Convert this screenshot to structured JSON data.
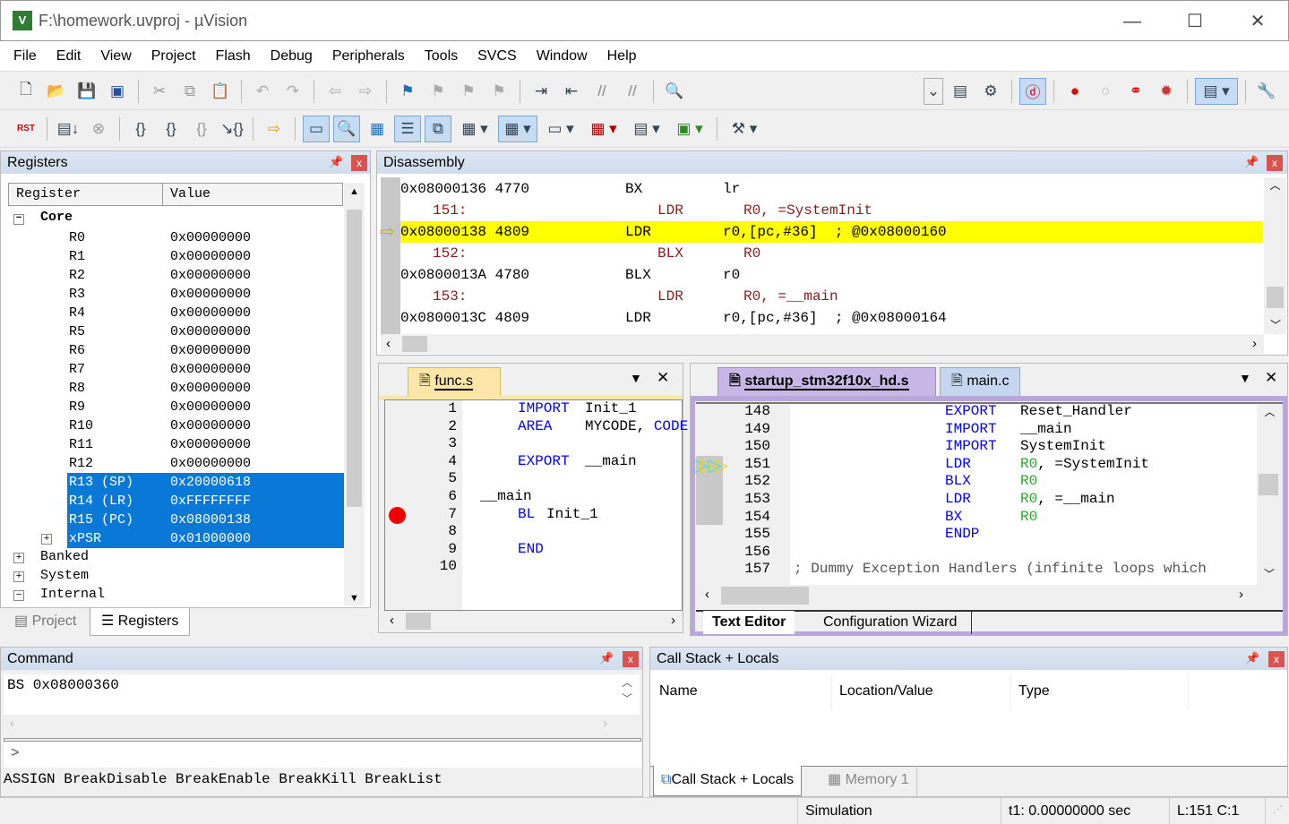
{
  "window": {
    "title": "F:\\homework.uvproj - µVision",
    "minimize": "—",
    "maximize": "☐",
    "close": "✕"
  },
  "menu": [
    "File",
    "Edit",
    "View",
    "Project",
    "Flash",
    "Debug",
    "Peripherals",
    "Tools",
    "SVCS",
    "Window",
    "Help"
  ],
  "toolbar1": [
    "new-file",
    "open-file",
    "save",
    "save-all",
    "cut",
    "copy",
    "paste",
    "undo",
    "redo",
    "back",
    "forward",
    "bookmark",
    "prev-bookmark",
    "next-bookmark",
    "clear-bookmarks",
    "indent",
    "unindent",
    "comment",
    "uncomment",
    "find-in-files",
    "select-target",
    "batch-build",
    "debug-session",
    "breakpoint-insert",
    "breakpoint-disable",
    "breakpoints-kill",
    "configure"
  ],
  "toolbar2": [
    "reset",
    "run",
    "stop",
    "step",
    "step-over",
    "step-out",
    "run-to-cursor",
    "show-next-statement",
    "command-window",
    "disassembly-window",
    "symbols-window",
    "registers-window",
    "call-stack-window",
    "watch-windows",
    "memory-windows",
    "serial-windows",
    "analysis-windows",
    "trace-windows",
    "system-viewer",
    "toolbox"
  ],
  "registers": {
    "title": "Registers",
    "col_register": "Register",
    "col_value": "Value",
    "core_label": "Core",
    "rows": [
      {
        "name": "R0",
        "value": "0x00000000"
      },
      {
        "name": "R1",
        "value": "0x00000000"
      },
      {
        "name": "R2",
        "value": "0x00000000"
      },
      {
        "name": "R3",
        "value": "0x00000000"
      },
      {
        "name": "R4",
        "value": "0x00000000"
      },
      {
        "name": "R5",
        "value": "0x00000000"
      },
      {
        "name": "R6",
        "value": "0x00000000"
      },
      {
        "name": "R7",
        "value": "0x00000000"
      },
      {
        "name": "R8",
        "value": "0x00000000"
      },
      {
        "name": "R9",
        "value": "0x00000000"
      },
      {
        "name": "R10",
        "value": "0x00000000"
      },
      {
        "name": "R11",
        "value": "0x00000000"
      },
      {
        "name": "R12",
        "value": "0x00000000"
      },
      {
        "name": "R13 (SP)",
        "value": "0x20000618",
        "selected": true
      },
      {
        "name": "R14 (LR)",
        "value": "0xFFFFFFFF",
        "selected": true
      },
      {
        "name": "R15 (PC)",
        "value": "0x08000138",
        "selected": true
      },
      {
        "name": "xPSR",
        "value": "0x01000000",
        "selected": true
      }
    ],
    "groups": [
      "Banked",
      "System",
      "Internal"
    ],
    "tabs": [
      "Project",
      "Registers"
    ]
  },
  "disassembly": {
    "title": "Disassembly",
    "lines": [
      {
        "type": "asm",
        "addr": "0x08000136 4770",
        "op": "BX",
        "args": "lr"
      },
      {
        "type": "src",
        "line": "151:",
        "op": "LDR",
        "args": "R0, =SystemInit"
      },
      {
        "type": "asm",
        "addr": "0x08000138 4809",
        "op": "LDR",
        "args": "r0,[pc,#36]  ; @0x08000160",
        "current": true
      },
      {
        "type": "src",
        "line": "152:",
        "op": "BLX",
        "args": "R0"
      },
      {
        "type": "asm",
        "addr": "0x0800013A 4780",
        "op": "BLX",
        "args": "r0"
      },
      {
        "type": "src",
        "line": "153:",
        "op": "LDR",
        "args": "R0, =__main"
      },
      {
        "type": "asm",
        "addr": "0x0800013C 4809",
        "op": "LDR",
        "args": "r0,[pc,#36]  ; @0x08000164"
      }
    ]
  },
  "func_editor": {
    "tab": "func.s",
    "lines": [
      {
        "n": "1",
        "label": "",
        "op": "IMPORT",
        "args": "Init_1"
      },
      {
        "n": "2",
        "label": "",
        "op": "AREA",
        "args": "MYCODE, ",
        "args2": "CODE"
      },
      {
        "n": "3",
        "label": "",
        "op": "",
        "args": ""
      },
      {
        "n": "4",
        "label": "",
        "op": "EXPORT",
        "args": "__main"
      },
      {
        "n": "5",
        "label": "",
        "op": "",
        "args": ""
      },
      {
        "n": "6",
        "label": "__main",
        "op": "",
        "args": ""
      },
      {
        "n": "7",
        "label": "",
        "op": "BL",
        "args": "Init_1",
        "breakpoint": true
      },
      {
        "n": "8",
        "label": "",
        "op": "",
        "args": ""
      },
      {
        "n": "9",
        "label": "",
        "op": "END",
        "args": ""
      },
      {
        "n": "10",
        "label": "",
        "op": "",
        "args": ""
      }
    ]
  },
  "startup_editor": {
    "tabs": [
      "startup_stm32f10x_hd.s",
      "main.c"
    ],
    "bottom_tabs": [
      "Text Editor",
      "Configuration Wizard"
    ],
    "lines": [
      {
        "n": "148",
        "op": "EXPORT",
        "reg": "",
        "args": "Reset_Handler"
      },
      {
        "n": "149",
        "op": "IMPORT",
        "reg": "",
        "args": "__main"
      },
      {
        "n": "150",
        "op": "IMPORT",
        "reg": "",
        "args": "SystemInit"
      },
      {
        "n": "151",
        "op": "LDR",
        "reg": "R0",
        "args": ", =SystemInit",
        "current": true
      },
      {
        "n": "152",
        "op": "BLX",
        "reg": "R0",
        "args": ""
      },
      {
        "n": "153",
        "op": "LDR",
        "reg": "R0",
        "args": ", =__main"
      },
      {
        "n": "154",
        "op": "BX",
        "reg": "R0",
        "args": ""
      },
      {
        "n": "155",
        "op": "ENDP",
        "reg": "",
        "args": ""
      },
      {
        "n": "156",
        "op": "",
        "reg": "",
        "args": ""
      },
      {
        "n": "157",
        "comment": "; Dummy Exception Handlers (infinite loops which"
      }
    ]
  },
  "command": {
    "title": "Command",
    "output": "BS 0x08000360",
    "prompt": ">",
    "help": "ASSIGN BreakDisable BreakEnable BreakKill BreakList"
  },
  "callstack": {
    "title": "Call Stack + Locals",
    "columns": [
      "Name",
      "Location/Value",
      "Type"
    ],
    "tabs": [
      "Call Stack + Locals",
      "Memory 1"
    ]
  },
  "status": {
    "mode": "Simulation",
    "time": "t1: 0.00000000 sec",
    "position": "L:151 C:1"
  },
  "colors": {
    "selection": "#0a78d7",
    "current_line": "#ffff00",
    "keyword": "#0000ff",
    "register": "#2aa52a",
    "editor_border": "#b9a7dc"
  }
}
